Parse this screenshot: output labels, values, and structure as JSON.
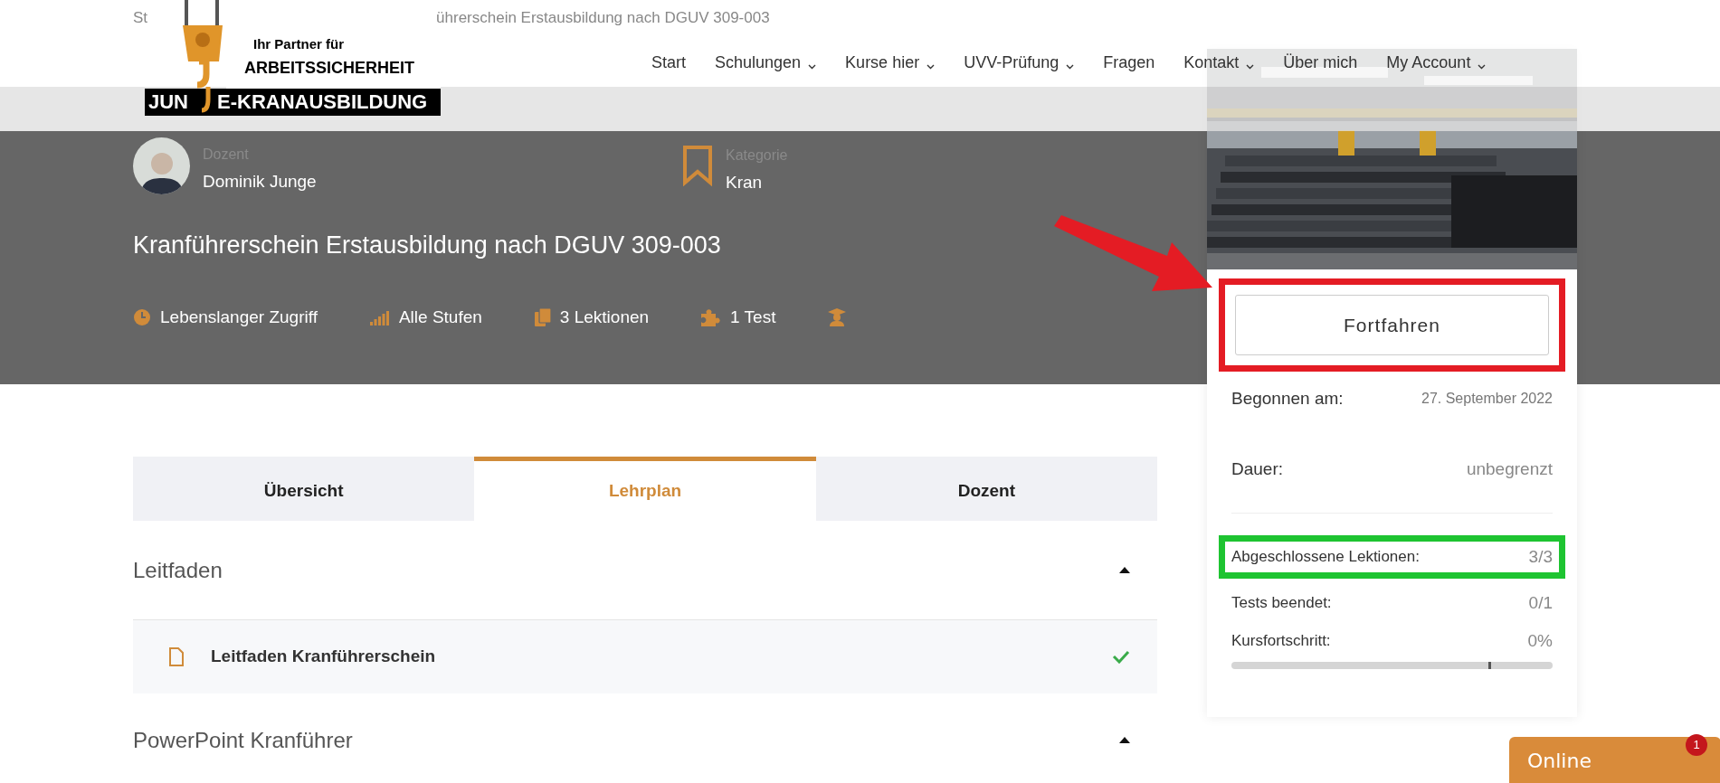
{
  "breadcrumb": {
    "start": "St",
    "end": "ührerschein Erstausbildung nach DGUV 309-003"
  },
  "logo": {
    "tagline_1": "Ihr Partner für",
    "tagline_2": "ARBEITSSICHERHEIT",
    "name_start": "JUN",
    "name_end": "E-KRANAUSBILDUNG"
  },
  "nav": [
    {
      "label": "Start",
      "dropdown": false
    },
    {
      "label": "Schulungen",
      "dropdown": true
    },
    {
      "label": "Kurse hier",
      "dropdown": true
    },
    {
      "label": "UVV-Prüfung",
      "dropdown": true
    },
    {
      "label": "Fragen",
      "dropdown": false
    },
    {
      "label": "Kontakt",
      "dropdown": true
    },
    {
      "label": "Über mich",
      "dropdown": false
    },
    {
      "label": "My Account",
      "dropdown": true
    }
  ],
  "course": {
    "instructor_label": "Dozent",
    "instructor": "Dominik Junge",
    "category_label": "Kategorie",
    "category": "Kran",
    "title": "Kranführerschein Erstausbildung nach DGUV 309-003",
    "meta": [
      {
        "kind": "clock",
        "text": "Lebenslanger Zugriff"
      },
      {
        "kind": "level",
        "text": "Alle Stufen"
      },
      {
        "kind": "lessons",
        "text": "3 Lektionen"
      },
      {
        "kind": "quiz",
        "text": "1 Test"
      },
      {
        "kind": "students"
      }
    ]
  },
  "tabs": [
    {
      "label": "Übersicht",
      "selected": false
    },
    {
      "label": "Lehrplan",
      "selected": true
    },
    {
      "label": "Dozent",
      "selected": false
    }
  ],
  "curriculum": [
    {
      "title": "Leitfaden",
      "expanded": true,
      "lessons": [
        {
          "title": "Leitfaden Kranführerschein",
          "completed": true
        }
      ]
    },
    {
      "title": "PowerPoint Kranführer",
      "expanded": true
    }
  ],
  "sidebar": {
    "button": "Fortfahren",
    "info": [
      {
        "label": "Begonnen am:",
        "value": "27. September 2022"
      },
      {
        "label": "Dauer:",
        "value": "unbegrenzt"
      }
    ],
    "stats": [
      {
        "label": "Abgeschlossene Lektionen:",
        "value": "3/3",
        "highlighted": true
      },
      {
        "label": "Tests beendet:",
        "value": "0/1",
        "highlighted": false
      },
      {
        "label": "Kursfortschritt:",
        "value": "0%",
        "highlighted": false
      }
    ],
    "progress": {
      "level": 0
    }
  },
  "chat": {
    "label": "Online",
    "badge": "1"
  }
}
